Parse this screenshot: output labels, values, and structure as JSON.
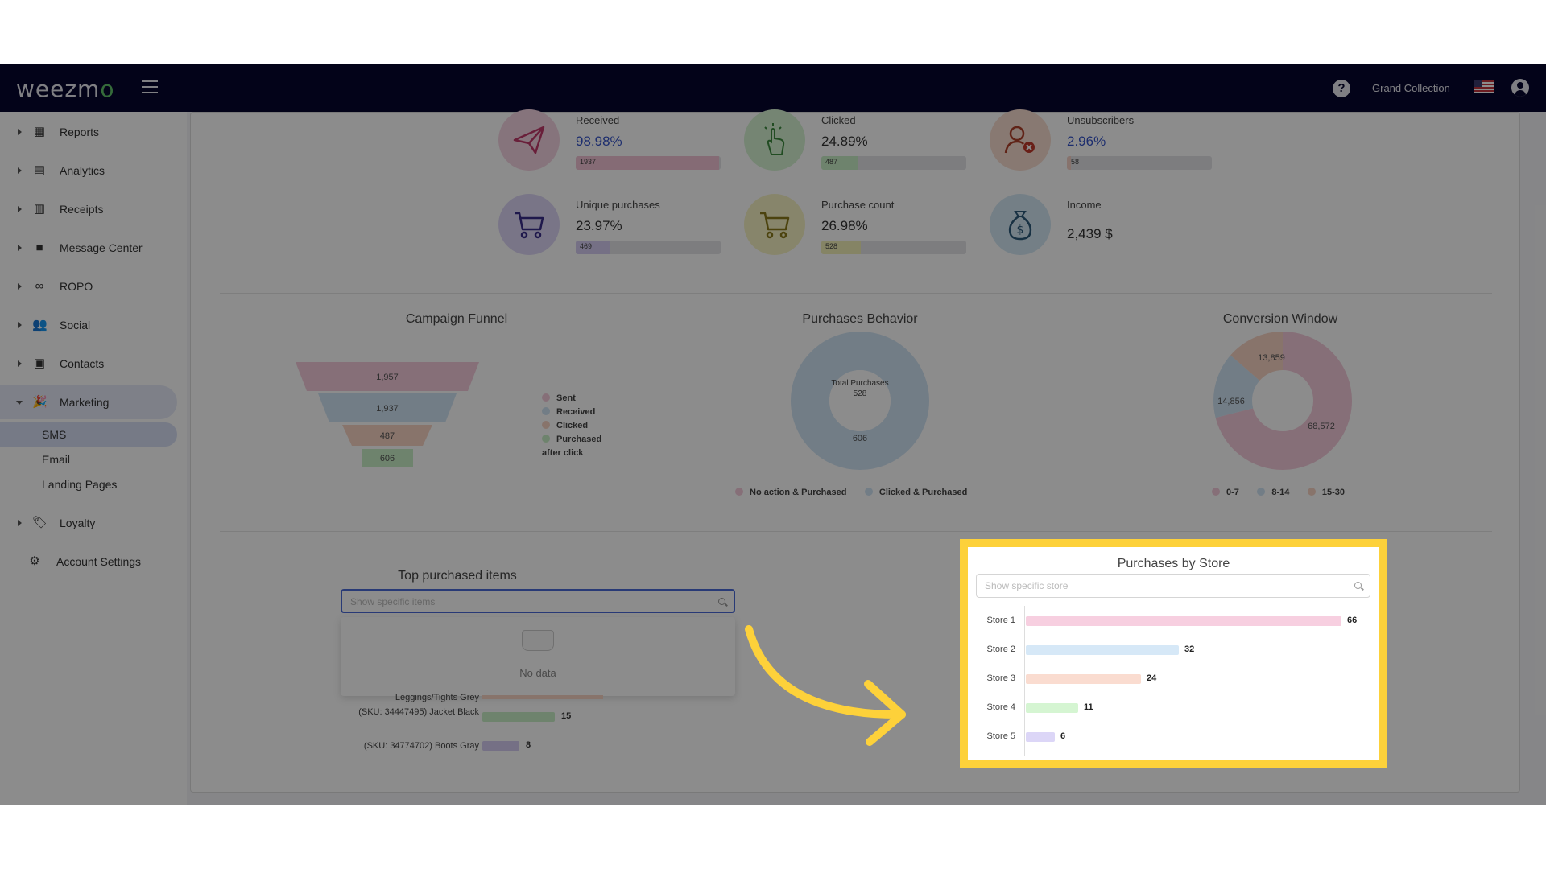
{
  "topbar": {
    "logo_text": "weezmo",
    "store_name": "Grand Collection"
  },
  "sidebar": {
    "items": [
      {
        "label": "Reports",
        "icon": "dashboard-icon"
      },
      {
        "label": "Analytics",
        "icon": "analytics-icon"
      },
      {
        "label": "Receipts",
        "icon": "receipt-icon"
      },
      {
        "label": "Message Center",
        "icon": "message-icon"
      },
      {
        "label": "ROPO",
        "icon": "infinity-icon"
      },
      {
        "label": "Social",
        "icon": "people-icon"
      },
      {
        "label": "Contacts",
        "icon": "contacts-icon"
      },
      {
        "label": "Marketing",
        "icon": "party-popper-icon"
      }
    ],
    "marketing_sub": [
      "SMS",
      "Email",
      "Landing Pages"
    ],
    "items_after": [
      {
        "label": "Loyalty",
        "icon": "tag-icon"
      },
      {
        "label": "Account Settings",
        "icon": "gear-icon"
      }
    ]
  },
  "kpis": [
    {
      "label": "Received",
      "value": "98.98%",
      "count": "1937",
      "fill": 0.99,
      "color": "#f2c4d6",
      "icon_bg": "#f5d4e2",
      "icon": "paper-plane-icon"
    },
    {
      "label": "Clicked",
      "value": "24.89%",
      "count": "487",
      "fill": 0.25,
      "color": "#c9efc6",
      "icon_bg": "#d5f3d2",
      "icon": "pointer-click-icon"
    },
    {
      "label": "Unsubscribers",
      "value": "2.96%",
      "count": "58",
      "fill": 0.03,
      "color": "#f6d2c6",
      "icon_bg": "#f8dccf",
      "icon": "user-remove-icon"
    },
    {
      "label": "Unique purchases",
      "value": "23.97%",
      "count": "469",
      "fill": 0.24,
      "color": "#d5cdf3",
      "icon_bg": "#ddd6f6",
      "icon": "cart-icon"
    },
    {
      "label": "Purchase count",
      "value": "26.98%",
      "count": "528",
      "fill": 0.27,
      "color": "#f3f0b8",
      "icon_bg": "#f6f3c4",
      "icon": "cart-icon"
    },
    {
      "label": "Income",
      "value": "2,439 $",
      "icon_bg": "#d3e8f5",
      "icon": "money-bag-icon"
    }
  ],
  "funnel": {
    "title": "Campaign Funnel",
    "values": [
      "1,957",
      "1,937",
      "487",
      "606"
    ],
    "legend": [
      "Sent",
      "Received",
      "Clicked",
      "Purchased after click"
    ],
    "colors": [
      "#f5cbdb",
      "#cfe3f4",
      "#f8d3c4",
      "#c9efc6"
    ]
  },
  "behavior": {
    "title": "Purchases Behavior",
    "center": "Total Purchases 528",
    "value_label": "606",
    "legend": [
      "No action & Purchased",
      "Clicked & Purchased"
    ],
    "colors": [
      "#f5cbdb",
      "#cfe3f4"
    ]
  },
  "conversion": {
    "title": "Conversion Window",
    "slices": [
      {
        "label": "0-7",
        "value": "68,572",
        "color": "#f5cbdb"
      },
      {
        "label": "8-14",
        "value": "14,856",
        "color": "#cfe3f4"
      },
      {
        "label": "15-30",
        "value": "13,859",
        "color": "#f8d3c4"
      }
    ]
  },
  "top_items": {
    "title": "Top purchased items",
    "search_placeholder": "Show specific items",
    "no_data": "No data",
    "rows": [
      {
        "label": "Leggings/Tights Grey",
        "value": "",
        "color": "#f8d3c4"
      },
      {
        "label": "(SKU: 34447495) Jacket Black",
        "value": "15",
        "color": "#c9efc6"
      },
      {
        "label": "(SKU: 34774702) Boots Gray",
        "value": "8",
        "color": "#d5cdf3"
      }
    ]
  },
  "by_store": {
    "title": "Purchases by Store",
    "search_placeholder": "Show specific store"
  },
  "chart_data": {
    "type": "bar",
    "title": "Purchases by Store",
    "orientation": "horizontal",
    "categories": [
      "Store 1",
      "Store 2",
      "Store 3",
      "Store 4",
      "Store 5"
    ],
    "values": [
      66,
      32,
      24,
      11,
      6
    ],
    "colors": [
      "#f7cfe0",
      "#d6e8f7",
      "#fadcd0",
      "#d5f5d2",
      "#dcd6f7"
    ],
    "xlim": [
      0,
      66
    ]
  }
}
